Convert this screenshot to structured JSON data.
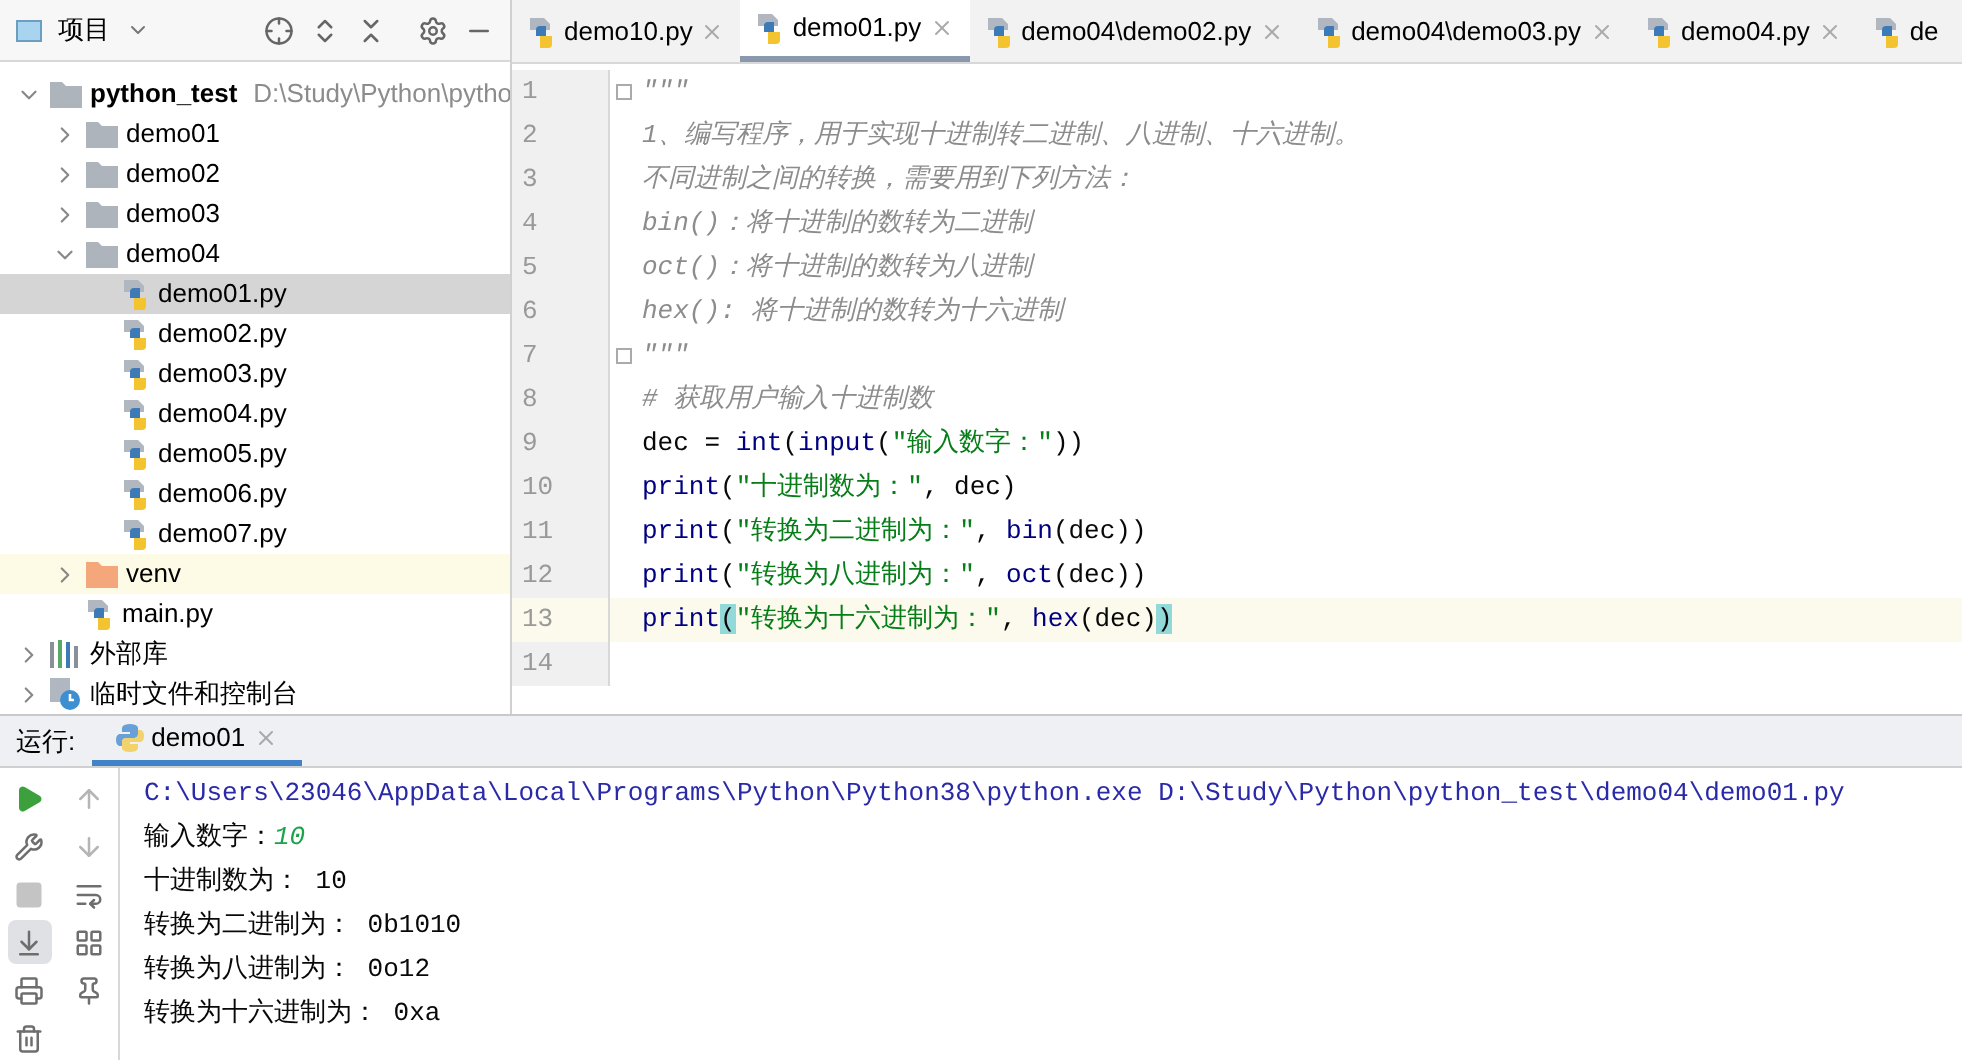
{
  "project_panel": {
    "title": "项目",
    "tree": [
      {
        "label": "python_test",
        "path": "D:\\Study\\Python\\pytho",
        "kind": "project",
        "expanded": true,
        "selected": false,
        "children": [
          {
            "label": "demo01",
            "kind": "folder",
            "expanded": false,
            "selected": false
          },
          {
            "label": "demo02",
            "kind": "folder",
            "expanded": false,
            "selected": false
          },
          {
            "label": "demo03",
            "kind": "folder",
            "expanded": false,
            "selected": false
          },
          {
            "label": "demo04",
            "kind": "folder",
            "expanded": true,
            "selected": false,
            "children": [
              {
                "label": "demo01.py",
                "kind": "python",
                "selected": true
              },
              {
                "label": "demo02.py",
                "kind": "python",
                "selected": false
              },
              {
                "label": "demo03.py",
                "kind": "python",
                "selected": false
              },
              {
                "label": "demo04.py",
                "kind": "python",
                "selected": false
              },
              {
                "label": "demo05.py",
                "kind": "python",
                "selected": false
              },
              {
                "label": "demo06.py",
                "kind": "python",
                "selected": false
              },
              {
                "label": "demo07.py",
                "kind": "python",
                "selected": false
              }
            ]
          },
          {
            "label": "venv",
            "kind": "excluded",
            "expanded": false,
            "selected": false
          },
          {
            "label": "main.py",
            "kind": "python",
            "selected": false
          }
        ]
      },
      {
        "label": "外部库",
        "kind": "library",
        "expanded": false,
        "selected": false
      },
      {
        "label": "临时文件和控制台",
        "kind": "scratch",
        "expanded": false,
        "selected": false
      }
    ]
  },
  "editor_tabs": [
    {
      "label": "demo10.py",
      "selected": false
    },
    {
      "label": "demo01.py",
      "selected": true
    },
    {
      "label": "demo04\\demo02.py",
      "selected": false
    },
    {
      "label": "demo04\\demo03.py",
      "selected": false
    },
    {
      "label": "demo04.py",
      "selected": false
    },
    {
      "label": "de",
      "selected": false
    }
  ],
  "code_lines": [
    {
      "number": "1",
      "current": false,
      "fold": true,
      "tokens": [
        {
          "kind": "doc",
          "text": "\"\"\""
        }
      ]
    },
    {
      "number": "2",
      "current": false,
      "fold": false,
      "tokens": [
        {
          "kind": "doc",
          "text": "1、编写程序，用于实现十进制转二进制、八进制、十六进制。"
        }
      ]
    },
    {
      "number": "3",
      "current": false,
      "fold": false,
      "tokens": [
        {
          "kind": "doc",
          "text": "不同进制之间的转换，需要用到下列方法："
        }
      ]
    },
    {
      "number": "4",
      "current": false,
      "fold": false,
      "tokens": [
        {
          "kind": "doc",
          "text": "bin()：将十进制的数转为二进制"
        }
      ]
    },
    {
      "number": "5",
      "current": false,
      "fold": false,
      "tokens": [
        {
          "kind": "doc",
          "text": "oct()：将十进制的数转为八进制"
        }
      ]
    },
    {
      "number": "6",
      "current": false,
      "fold": false,
      "tokens": [
        {
          "kind": "doc",
          "text": "hex(): 将十进制的数转为十六进制"
        }
      ]
    },
    {
      "number": "7",
      "current": false,
      "fold": true,
      "tokens": [
        {
          "kind": "doc",
          "text": "\"\"\""
        }
      ]
    },
    {
      "number": "8",
      "current": false,
      "fold": false,
      "tokens": [
        {
          "kind": "comment",
          "text": "# 获取用户输入十进制数"
        }
      ]
    },
    {
      "number": "9",
      "current": false,
      "fold": false,
      "tokens": [
        {
          "kind": "plain",
          "text": "dec = "
        },
        {
          "kind": "builtin",
          "text": "int"
        },
        {
          "kind": "plain",
          "text": "("
        },
        {
          "kind": "builtin",
          "text": "input"
        },
        {
          "kind": "plain",
          "text": "("
        },
        {
          "kind": "string",
          "text": "\"输入数字：\""
        },
        {
          "kind": "plain",
          "text": "))"
        }
      ]
    },
    {
      "number": "10",
      "current": false,
      "fold": false,
      "tokens": [
        {
          "kind": "builtin",
          "text": "print"
        },
        {
          "kind": "plain",
          "text": "("
        },
        {
          "kind": "string",
          "text": "\"十进制数为：\""
        },
        {
          "kind": "plain",
          "text": ", dec)"
        }
      ]
    },
    {
      "number": "11",
      "current": false,
      "fold": false,
      "tokens": [
        {
          "kind": "builtin",
          "text": "print"
        },
        {
          "kind": "plain",
          "text": "("
        },
        {
          "kind": "string",
          "text": "\"转换为二进制为：\""
        },
        {
          "kind": "plain",
          "text": ", "
        },
        {
          "kind": "builtin",
          "text": "bin"
        },
        {
          "kind": "plain",
          "text": "(dec))"
        }
      ]
    },
    {
      "number": "12",
      "current": false,
      "fold": false,
      "tokens": [
        {
          "kind": "builtin",
          "text": "print"
        },
        {
          "kind": "plain",
          "text": "("
        },
        {
          "kind": "string",
          "text": "\"转换为八进制为：\""
        },
        {
          "kind": "plain",
          "text": ", "
        },
        {
          "kind": "builtin",
          "text": "oct"
        },
        {
          "kind": "plain",
          "text": "(dec))"
        }
      ]
    },
    {
      "number": "13",
      "current": true,
      "fold": false,
      "tokens": [
        {
          "kind": "builtin",
          "text": "print"
        },
        {
          "kind": "bracket",
          "text": "("
        },
        {
          "kind": "string",
          "text": "\"转换为十六进制为：\""
        },
        {
          "kind": "plain",
          "text": ", "
        },
        {
          "kind": "builtin",
          "text": "hex"
        },
        {
          "kind": "plain",
          "text": "(dec)"
        },
        {
          "kind": "bracket",
          "text": ")"
        }
      ]
    },
    {
      "number": "14",
      "current": false,
      "fold": false
    }
  ],
  "run_panel": {
    "label": "运行:",
    "tab": {
      "label": "demo01",
      "selected": true
    },
    "output": [
      [
        {
          "kind": "command",
          "text": "C:\\Users\\23046\\AppData\\Local\\Programs\\Python\\Python38\\python.exe D:\\Study\\Python\\python_test\\demo04\\demo01.py"
        }
      ],
      [
        {
          "kind": "plain",
          "text": "输入数字："
        },
        {
          "kind": "input",
          "text": "10"
        }
      ],
      [
        {
          "kind": "plain",
          "text": "十进制数为： 10"
        }
      ],
      [
        {
          "kind": "plain",
          "text": "转换为二进制为： 0b1010"
        }
      ],
      [
        {
          "kind": "plain",
          "text": "转换为八进制为： 0o12"
        }
      ],
      [
        {
          "kind": "plain",
          "text": "转换为十六进制为： 0xa"
        }
      ]
    ],
    "toolbar": [
      {
        "selected": false
      },
      {
        "selected": false
      },
      {
        "selected": false
      },
      {
        "selected": false
      },
      {
        "selected": false
      },
      {
        "selected": false
      },
      {
        "selected": true
      },
      {
        "selected": false
      },
      {
        "selected": false
      },
      {
        "selected": false
      },
      {
        "selected": false
      }
    ]
  }
}
